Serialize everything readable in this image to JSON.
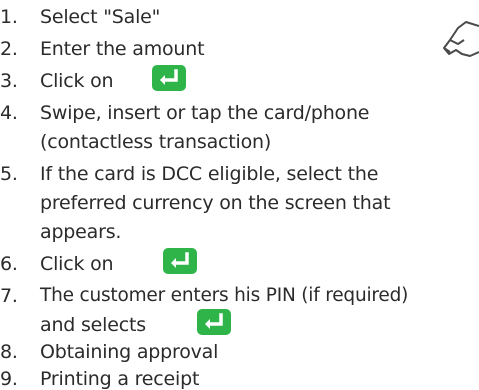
{
  "instructions": {
    "steps": [
      {
        "number": "1.",
        "lines": [
          "Select \"Sale\""
        ]
      },
      {
        "number": "2.",
        "lines": [
          "Enter the amount"
        ]
      },
      {
        "number": "3.",
        "lines": [
          "Click on"
        ]
      },
      {
        "number": "4.",
        "lines": [
          "Swipe, insert or tap the card/phone",
          "(contactless transaction)"
        ]
      },
      {
        "number": "5.",
        "lines": [
          "If the card is DCC eligible, select the",
          "preferred currency on the screen that",
          "appears."
        ]
      },
      {
        "number": "6.",
        "lines": [
          "Click on"
        ]
      },
      {
        "number": "7.",
        "lines": [
          "The customer enters his PIN (if required)",
          "and selects"
        ]
      },
      {
        "number": "8.",
        "lines": [
          "Obtaining approval"
        ]
      },
      {
        "number": "9.",
        "lines": [
          "Printing a receipt"
        ]
      }
    ]
  },
  "icons": {
    "enter_key": "enter-key-icon",
    "corner": "card-tap-icon"
  },
  "colors": {
    "text": "#2b2b2b",
    "enter_key_bg": "#2fb44a",
    "enter_key_glyph": "#ffffff"
  }
}
